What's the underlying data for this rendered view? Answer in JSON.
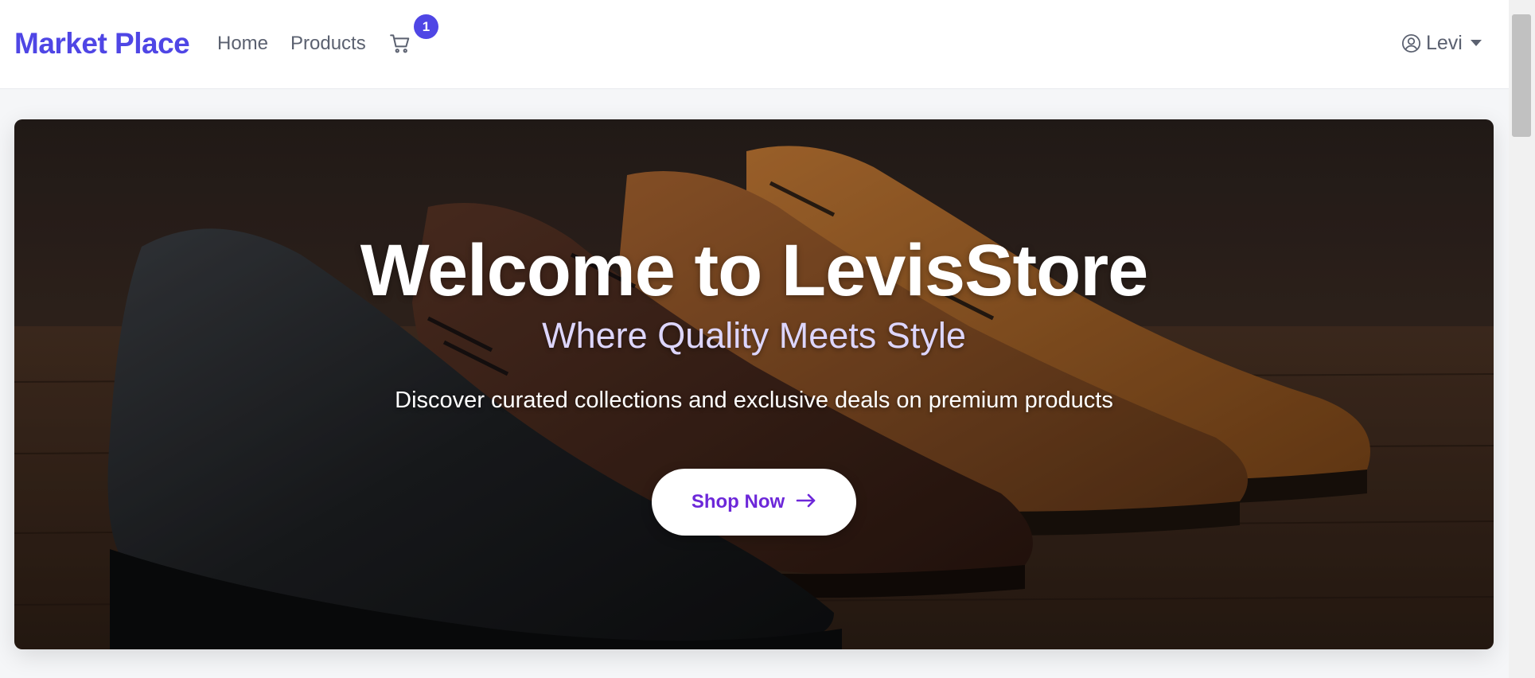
{
  "navbar": {
    "brand": "Market Place",
    "links": [
      {
        "label": "Home"
      },
      {
        "label": "Products"
      }
    ],
    "cart": {
      "icon": "cart-icon",
      "count": "1"
    },
    "user": {
      "icon": "user-circle-icon",
      "name": "Levi",
      "menu_icon": "caret-down-icon"
    }
  },
  "hero": {
    "title": "Welcome to LevisStore",
    "subtitle": "Where Quality Meets Style",
    "text": "Discover curated collections and exclusive deals on premium products",
    "cta_label": "Shop Now",
    "cta_icon": "arrow-right-icon",
    "image": "dress-shoes-photo"
  },
  "colors": {
    "brand": "#4f46e5",
    "badge": "#4f46e5",
    "subtitle": "#ddd6fe",
    "cta_text": "#6d28d9"
  }
}
